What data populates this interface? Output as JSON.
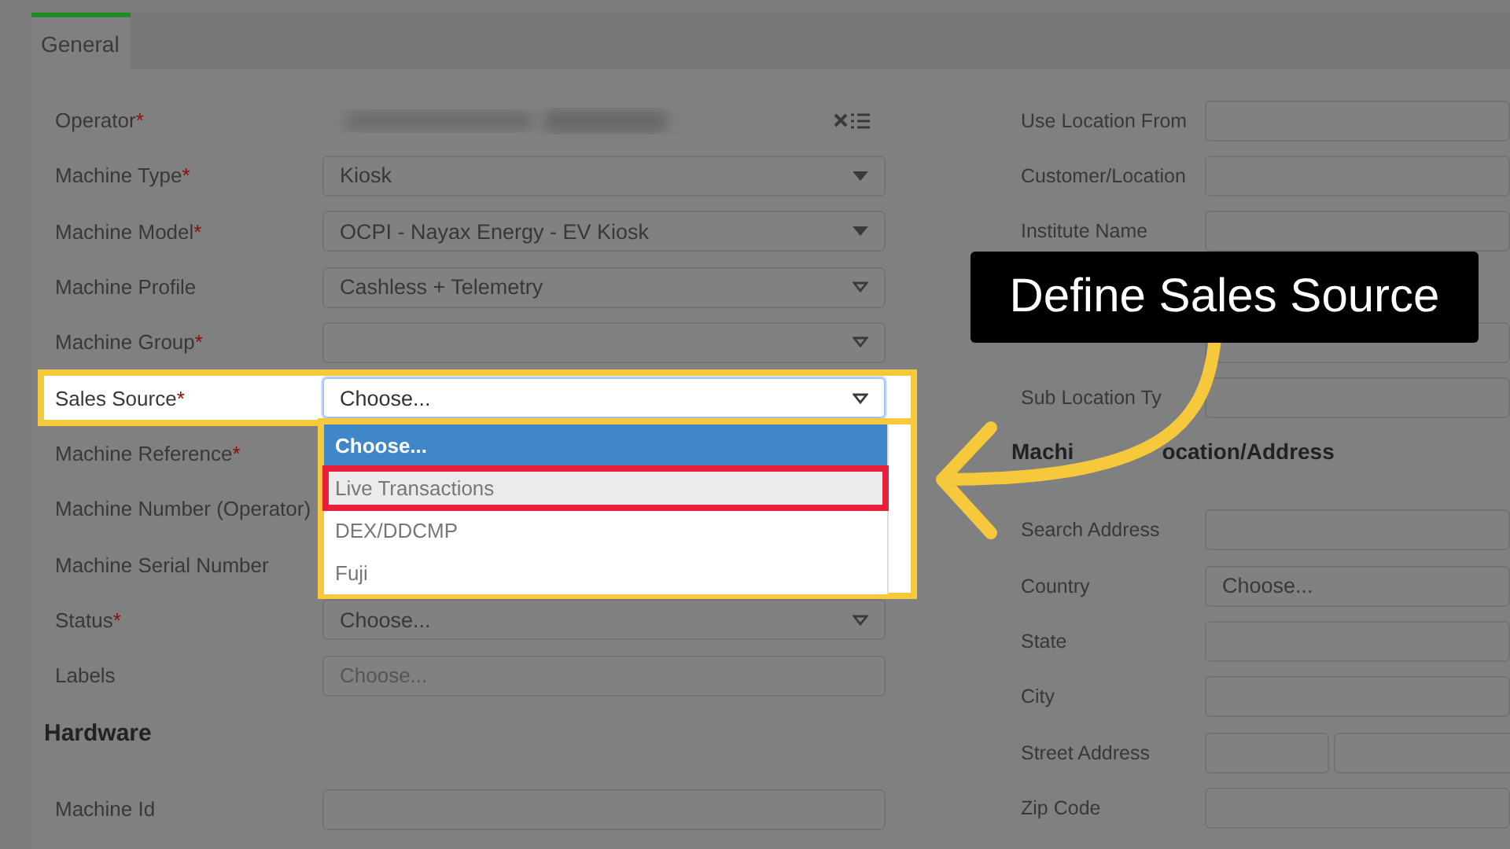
{
  "tabs": [
    {
      "label": "General",
      "selected": true
    }
  ],
  "left_fields": [
    {
      "label": "Operator",
      "mark": "*",
      "kind": "blurred"
    },
    {
      "label": "Machine Type",
      "mark": "*",
      "kind": "select",
      "value": "Kiosk",
      "arrow_filled": true
    },
    {
      "label": "Machine Model",
      "mark": "*",
      "kind": "select",
      "value": "OCPI - Nayax Energy - EV Kiosk",
      "arrow_filled": true
    },
    {
      "label": "Machine Profile",
      "kind": "select",
      "value": "Cashless + Telemetry",
      "arrow_filled": false
    },
    {
      "label": "Machine Group",
      "mark": "*",
      "kind": "select",
      "arrow_filled": false
    },
    {
      "label": "Sales Source",
      "mark": "*",
      "kind": "select",
      "value": "Choose...",
      "arrow_filled": false,
      "highlighted": true,
      "focused": true,
      "dropdown": [
        {
          "label": "Choose...",
          "selected": true,
          "hovered": false,
          "marked": false
        },
        {
          "label": "Live Transactions",
          "selected": false,
          "hovered": true,
          "marked": true
        },
        {
          "label": "DEX/DDCMP",
          "selected": false,
          "hovered": false,
          "marked": false
        },
        {
          "label": "Fuji",
          "selected": false,
          "hovered": false,
          "marked": false
        }
      ]
    },
    {
      "label": "Machine Reference",
      "mark": "*",
      "kind": "covered"
    },
    {
      "label": "Machine Number (Operator)",
      "kind": "covered"
    },
    {
      "label": "Machine Serial Number",
      "kind": "covered"
    },
    {
      "label": "Status",
      "mark": "*",
      "kind": "select",
      "value": "Choose...",
      "arrow_filled": false
    },
    {
      "label": "Labels",
      "kind": "text",
      "placeholder": "Choose..."
    }
  ],
  "hardware": {
    "title": "Hardware",
    "fields": [
      {
        "label": "Machine Id",
        "kind": "text"
      }
    ]
  },
  "right_fields": [
    {
      "label": "Use Location From",
      "kind": "text"
    },
    {
      "label": "Customer/Location",
      "kind": "text"
    },
    {
      "label": "Institute Name",
      "kind": "text"
    },
    {
      "kind": "text"
    },
    {
      "label": "Sub Location Ty",
      "kind": "text"
    }
  ],
  "location": {
    "title_parts": [
      "Machi",
      "ocation/Address"
    ],
    "fields": [
      {
        "label": "Search Address",
        "kind": "text"
      },
      {
        "label": "Country",
        "kind": "select",
        "value": "Choose..."
      },
      {
        "label": "State",
        "kind": "text"
      },
      {
        "label": "City",
        "kind": "text"
      },
      {
        "label": "Street Address",
        "kind": "split"
      },
      {
        "label": "Zip Code",
        "kind": "text"
      }
    ]
  },
  "callout": {
    "text": "Define Sales Source"
  }
}
